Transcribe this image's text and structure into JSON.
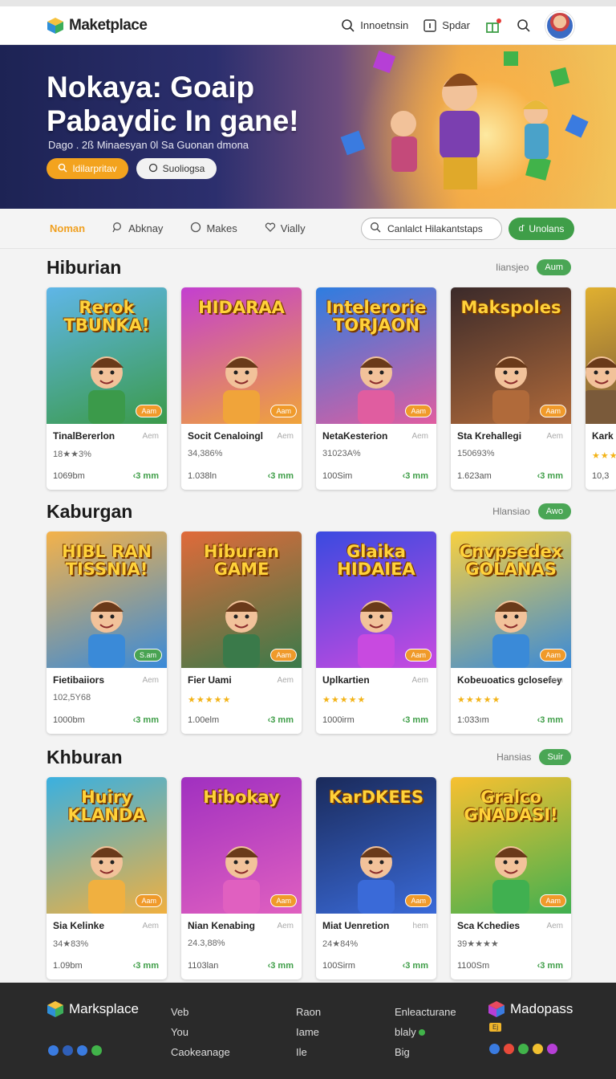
{
  "header": {
    "brand": "Maketplace",
    "links": [
      {
        "label": "Innoetnsin",
        "icon": "search-icon"
      },
      {
        "label": "Spdar",
        "icon": "info-icon"
      }
    ]
  },
  "hero": {
    "title": "Nokaya: Goaip Pabaydic In gane!",
    "subtitle": "Dago . 2ß Minaesyan 0l Sa Guonan dmona",
    "primary_button": "Idilarpritav",
    "secondary_button": "Suoliogsa"
  },
  "nav": {
    "items": [
      "Noman",
      "Abknay",
      "Makes",
      "Vially"
    ],
    "search_label": "Canlalct Hilakantstaps",
    "green_button": "Unolans"
  },
  "sections": [
    {
      "title": "Hiburian",
      "more": "Iiansjeo",
      "pill": "Aum",
      "cards": [
        {
          "art": "Rerok TBUNKA!",
          "tag": "Aam",
          "name": "TinalBererlon",
          "aux": "Aem",
          "meta": "18★★3%",
          "price": "1069bm",
          "buy": "‹3 mm"
        },
        {
          "art": "HIDARAA",
          "tag": "Aam",
          "name": "Socit Cenaloingl",
          "aux": "Aem",
          "meta": "34,386%",
          "price": "1.038ln",
          "buy": "‹3 mm"
        },
        {
          "art": "Intelerorie TORJAON",
          "tag": "Aam",
          "name": "NetaKesterion",
          "aux": "Aem",
          "meta": "31023A%",
          "price": "100Sim",
          "buy": "‹3 mm"
        },
        {
          "art": "Makspoles",
          "tag": "Aam",
          "name": "Sta Krehallegi",
          "aux": "Aem",
          "meta": "150693%",
          "price": "1.623am",
          "buy": "‹3 mm"
        },
        {
          "art": "",
          "tag": "",
          "name": "Kark",
          "aux": "",
          "meta": "★★★",
          "price": "10,3",
          "buy": ""
        }
      ]
    },
    {
      "title": "Kaburgan",
      "more": "Hlansiao",
      "pill": "Awo",
      "cards": [
        {
          "art": "HIBL RAN TISSNIA!",
          "tag": "S.am",
          "name": "Fietibaiiors",
          "aux": "Aem",
          "meta": "102,5Y68",
          "price": "1000bm",
          "buy": "‹3 mm"
        },
        {
          "art": "Hiburan GAME",
          "tag": "Aam",
          "name": "Fier Uami",
          "aux": "Aem",
          "meta": "★★★★★",
          "price": "1.00elm",
          "buy": "‹3 mm"
        },
        {
          "art": "Glaika HIDAIEA",
          "tag": "Aam",
          "name": "Uplkartien",
          "aux": "Aem",
          "meta": "★★★★★",
          "price": "1000irm",
          "buy": "‹3 mm"
        },
        {
          "art": "Cnvpsedex GOLANAS",
          "tag": "Aam",
          "name": "Kobeuoatics gclosefey",
          "aux": "Aem",
          "meta": "★★★★★",
          "price": "1:033ım",
          "buy": "‹3 mm"
        }
      ]
    },
    {
      "title": "Khburan",
      "more": "Hansias",
      "pill": "Suir",
      "cards": [
        {
          "art": "Huiry KLANDA",
          "tag": "Aam",
          "name": "Sia Kelinke",
          "aux": "Aem",
          "meta": "34★83%",
          "price": "1.09bm",
          "buy": "‹3 mm"
        },
        {
          "art": "Hibokay",
          "tag": "Aam",
          "name": "Nian Kenabing",
          "aux": "Aem",
          "meta": "24.3,88%",
          "price": "1103lan",
          "buy": "‹3 mm"
        },
        {
          "art": "KarDKEES",
          "tag": "Aam",
          "name": "Miat Uenretion",
          "aux": "hem",
          "meta": "24★84%",
          "price": "100Sirm",
          "buy": "‹3 mm"
        },
        {
          "art": "Gralco GNADASI!",
          "tag": "Aam",
          "name": "Sca Kchedies",
          "aux": "Aem",
          "meta": "39★★★★",
          "price": "1100Sm",
          "buy": "‹3 mm"
        }
      ]
    }
  ],
  "footer": {
    "brand": "Marksplace",
    "col1": [
      "Veb",
      "You",
      "Caokeanage"
    ],
    "col2": [
      "Raon",
      "Iame",
      "Ile"
    ],
    "col3": [
      "Enleacturane",
      "blaly",
      "Big"
    ],
    "brand2": "Madopass",
    "badge": "Ej"
  },
  "colors": {
    "accent": "#f3a31e",
    "green": "#3f9e48",
    "footer_bg": "#2a2a2a"
  }
}
